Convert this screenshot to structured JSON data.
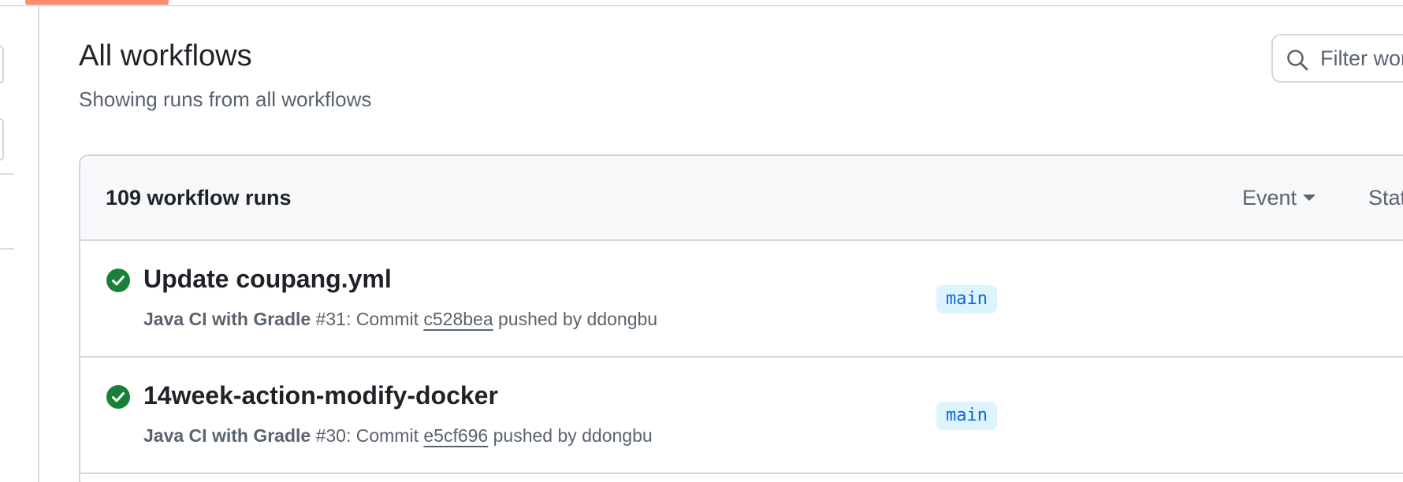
{
  "header": {
    "title": "All workflows",
    "subtitle": "Showing runs from all workflows"
  },
  "search": {
    "placeholder": "Filter workflow runs",
    "icon": "search-icon"
  },
  "runs": {
    "count_label": "109 workflow runs",
    "filters": [
      {
        "label": "Event"
      },
      {
        "label": "Status"
      }
    ],
    "items": [
      {
        "title": "Update coupang.yml",
        "status": "success",
        "workflow": "Java CI with Gradle",
        "run_number": "#31",
        "commit_prefix": ": Commit",
        "commit_sha": "c528bea",
        "pushed_by_label": "pushed by",
        "author": "ddongbu",
        "branch": "main"
      },
      {
        "title": "14week-action-modify-docker",
        "status": "success",
        "workflow": "Java CI with Gradle",
        "run_number": "#30",
        "commit_prefix": ": Commit",
        "commit_sha": "e5cf696",
        "pushed_by_label": "pushed by",
        "author": "ddongbu",
        "branch": "main"
      }
    ]
  },
  "colors": {
    "success": "#1a7f37",
    "link": "#0969da",
    "badge_bg": "#ddf4ff",
    "muted": "#59636e",
    "accent_underline": "#fd8c73"
  }
}
